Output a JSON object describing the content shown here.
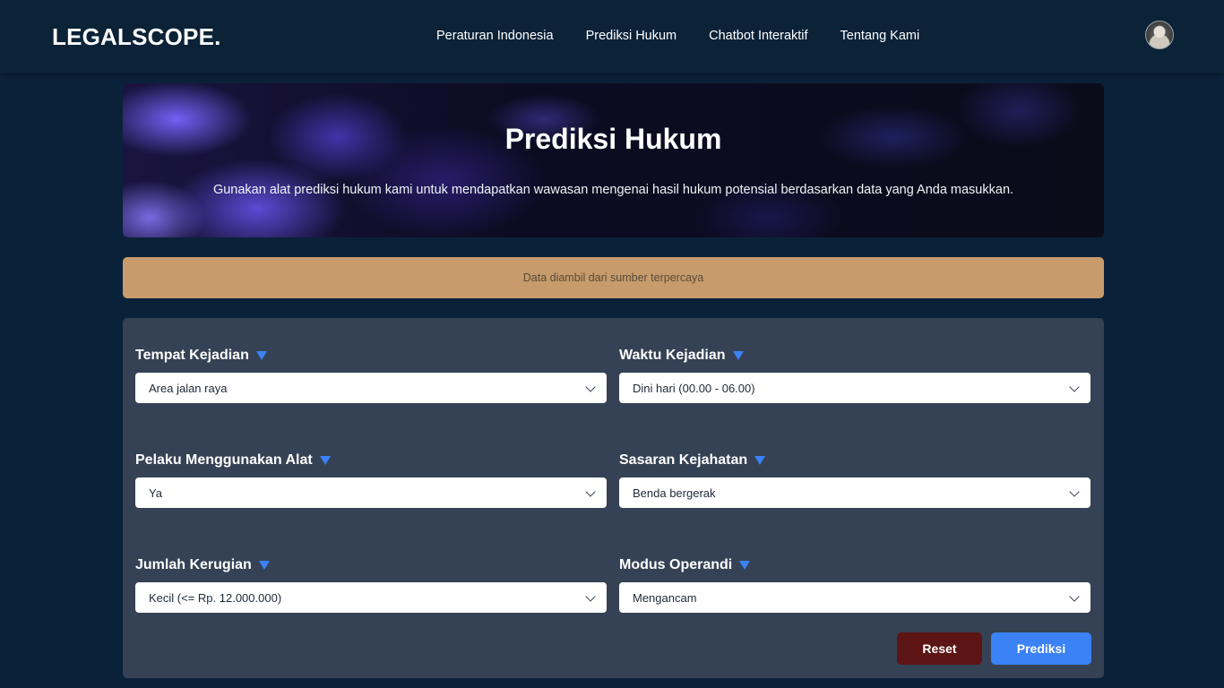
{
  "brand": "LEGALSCOPE.",
  "nav": {
    "links": [
      "Peraturan Indonesia",
      "Prediksi Hukum",
      "Chatbot Interaktif",
      "Tentang Kami"
    ],
    "avatar_icon": "user-avatar"
  },
  "hero": {
    "title": "Prediksi Hukum",
    "subtitle": "Gunakan alat prediksi hukum kami untuk mendapatkan wawasan mengenai hasil hukum potensial berdasarkan data yang Anda masukkan."
  },
  "notice": "Data diambil dari sumber terpercaya",
  "form": {
    "fields": [
      {
        "label": "Tempat Kejadian",
        "value": "Area jalan raya"
      },
      {
        "label": "Waktu Kejadian",
        "value": "Dini hari (00.00 - 06.00)"
      },
      {
        "label": "Pelaku Menggunakan Alat",
        "value": "Ya"
      },
      {
        "label": "Sasaran Kejahatan",
        "value": "Benda bergerak"
      },
      {
        "label": "Jumlah Kerugian",
        "value": "Kecil (<= Rp. 12.000.000)"
      },
      {
        "label": "Modus Operandi",
        "value": "Mengancam"
      }
    ],
    "reset_label": "Reset",
    "predict_label": "Prediksi"
  },
  "colors": {
    "background": "#0a2239",
    "panel": "#354154",
    "notice": "#c79b6b",
    "accent": "#3b82f6",
    "reset": "#5c1414"
  }
}
